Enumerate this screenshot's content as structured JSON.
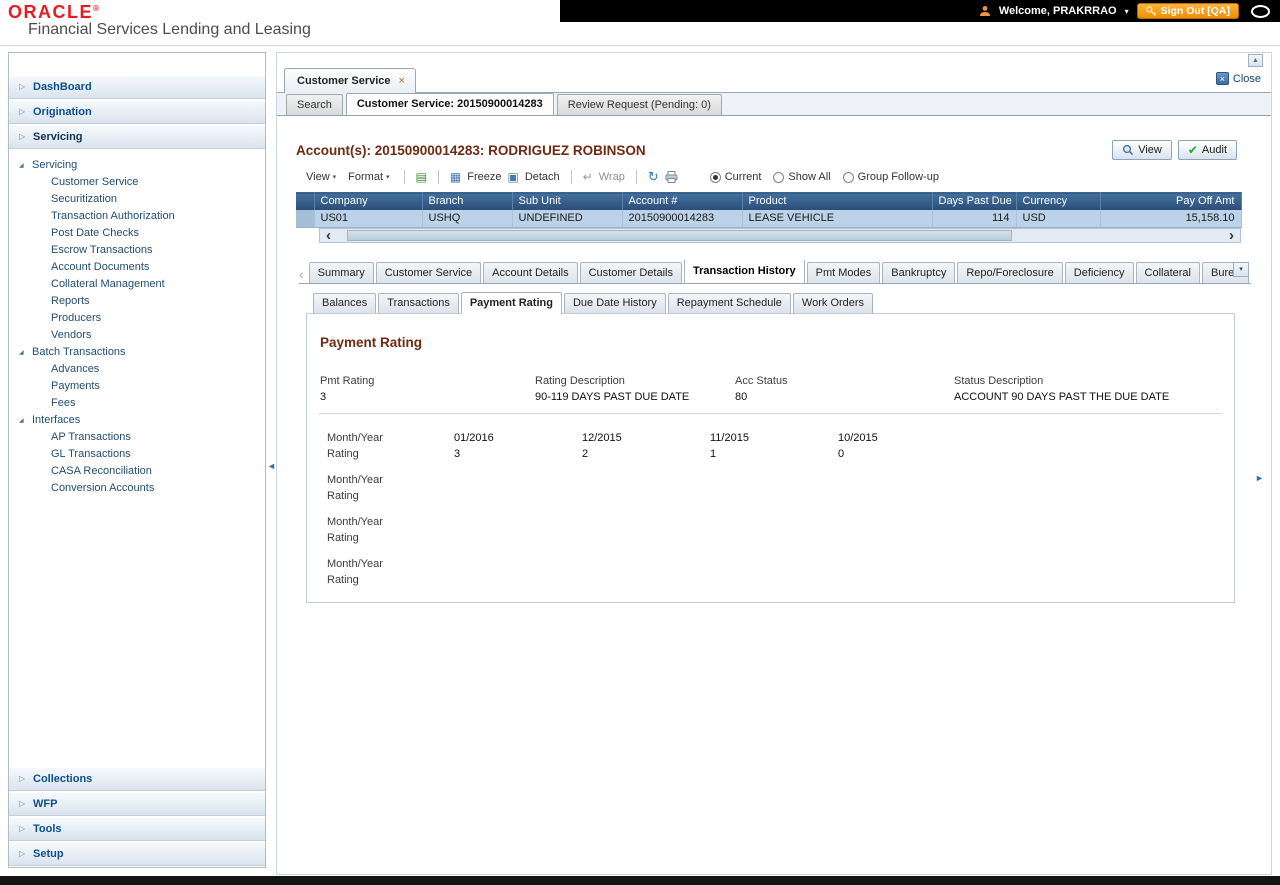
{
  "header": {
    "logo_text": "ORACLE",
    "logo_mark": "®",
    "product_name": "Financial Services Lending and Leasing",
    "welcome_label": "Welcome, PRAKRRAO",
    "signout_label": "Sign Out [QA]"
  },
  "icons": {
    "scroll_up": "▲",
    "chevron": "▷",
    "tree_expanded": "◢",
    "tab_close": "×",
    "close_x": "×",
    "menu_caret": "▾",
    "export": "▤",
    "freeze": "▦",
    "detach": "▣",
    "wrap": "↵",
    "refresh": "↻",
    "scroll_left": "‹",
    "scroll_right": "›",
    "tabs_left": "‹",
    "tabs_right": "›",
    "tabs_drop": "▾",
    "splitter_left": "◄",
    "splitter_right": "►",
    "audit_check": "✔",
    "welcome_caret": "▾"
  },
  "sidebar": {
    "top_sections": [
      {
        "label": "DashBoard"
      },
      {
        "label": "Origination"
      },
      {
        "label": "Servicing"
      }
    ],
    "tree": [
      {
        "label": "Servicing",
        "children": [
          "Customer Service",
          "Securitization",
          "Transaction Authorization",
          "Post Date Checks",
          "Escrow Transactions",
          "Account Documents",
          "Collateral Management",
          "Reports",
          "Producers",
          "Vendors"
        ]
      },
      {
        "label": "Batch Transactions",
        "children": [
          "Advances",
          "Payments",
          "Fees"
        ]
      },
      {
        "label": "Interfaces",
        "children": [
          "AP Transactions",
          "GL Transactions",
          "CASA Reconciliation",
          "Conversion Accounts"
        ]
      }
    ],
    "bottom_sections": [
      {
        "label": "Collections"
      },
      {
        "label": "WFP"
      },
      {
        "label": "Tools"
      },
      {
        "label": "Setup"
      }
    ]
  },
  "window": {
    "tab_label": "Customer Service",
    "close_label": "Close"
  },
  "page_tabs": [
    {
      "label": "Search"
    },
    {
      "label": "Customer Service: 20150900014283"
    },
    {
      "label": "Review Request (Pending: 0)"
    }
  ],
  "account": {
    "title": "Account(s): 20150900014283: RODRIGUEZ ROBINSON",
    "view_button": "View",
    "audit_button": "Audit"
  },
  "toolbar": {
    "view_menu": "View",
    "format_menu": "Format",
    "freeze": "Freeze",
    "detach": "Detach",
    "wrap": "Wrap",
    "radio_options": [
      {
        "label": "Current",
        "selected": true
      },
      {
        "label": "Show All",
        "selected": false
      },
      {
        "label": "Group Follow-up",
        "selected": false
      }
    ]
  },
  "accounts_grid": {
    "columns": [
      "Company",
      "Branch",
      "Sub Unit",
      "Account #",
      "Product",
      "Days Past Due",
      "Currency",
      "Pay Off Amt"
    ],
    "row": {
      "company": "US01",
      "branch": "USHQ",
      "sub_unit": "UNDEFINED",
      "account_no": "20150900014283",
      "product": "LEASE VEHICLE",
      "days_past_due": "114",
      "currency": "USD",
      "pay_off_amt": "15,158.10"
    }
  },
  "detail_tabs": [
    "Summary",
    "Customer Service",
    "Account Details",
    "Customer Details",
    "Transaction History",
    "Pmt Modes",
    "Bankruptcy",
    "Repo/Foreclosure",
    "Deficiency",
    "Collateral",
    "Burea"
  ],
  "history_tabs": [
    "Balances",
    "Transactions",
    "Payment Rating",
    "Due Date History",
    "Repayment Schedule",
    "Work Orders"
  ],
  "payment_rating": {
    "title": "Payment Rating",
    "fields": [
      {
        "label": "Pmt Rating",
        "value": "3"
      },
      {
        "label": "Rating Description",
        "value": "90-119 DAYS PAST DUE DATE"
      },
      {
        "label": "Acc Status",
        "value": "80"
      },
      {
        "label": "Status Description",
        "value": "ACCOUNT 90 DAYS PAST THE DUE DATE"
      }
    ],
    "month_year_label": "Month/Year",
    "rating_label": "Rating",
    "rating_history": [
      {
        "months": [
          "01/2016",
          "12/2015",
          "11/2015",
          "10/2015"
        ],
        "ratings": [
          "3",
          "2",
          "1",
          "0"
        ]
      },
      {
        "months": [
          "",
          "",
          "",
          ""
        ],
        "ratings": [
          "",
          "",
          "",
          ""
        ]
      },
      {
        "months": [
          "",
          "",
          "",
          ""
        ],
        "ratings": [
          "",
          "",
          "",
          ""
        ]
      },
      {
        "months": [
          "",
          "",
          "",
          ""
        ],
        "ratings": [
          "",
          "",
          "",
          ""
        ]
      }
    ]
  }
}
